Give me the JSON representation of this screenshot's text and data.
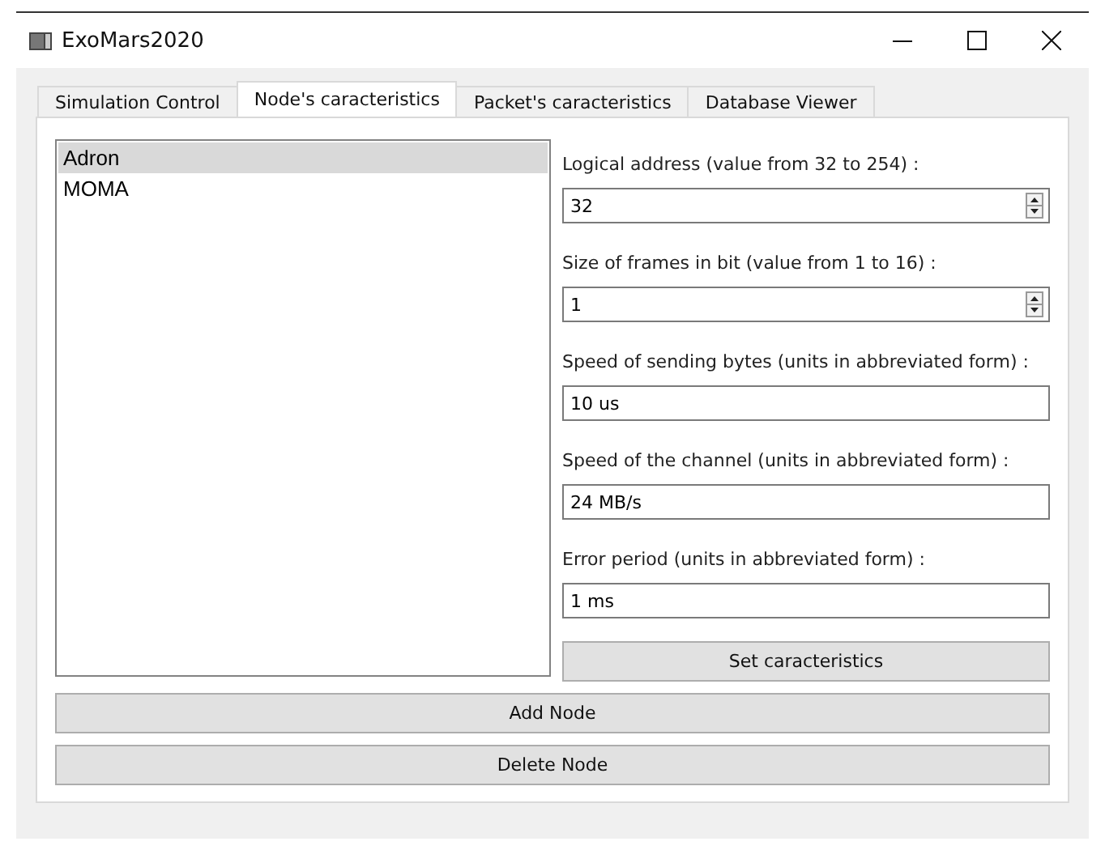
{
  "window": {
    "title": "ExoMars2020"
  },
  "tabs": [
    {
      "label": "Simulation Control",
      "selected": false
    },
    {
      "label": "Node's caracteristics",
      "selected": true
    },
    {
      "label": "Packet's caracteristics",
      "selected": false
    },
    {
      "label": "Database Viewer",
      "selected": false
    }
  ],
  "nodes": [
    {
      "label": "Adron",
      "selected": true
    },
    {
      "label": "MOMA",
      "selected": false
    }
  ],
  "fields": [
    {
      "kind": "spin",
      "label": "Logical address (value from 32 to 254) :",
      "value": "32"
    },
    {
      "kind": "spin",
      "label": "Size of frames in bit (value from 1 to 16) :",
      "value": "1"
    },
    {
      "kind": "text",
      "label": "Speed of sending bytes (units in abbreviated form) :",
      "value": "10 us"
    },
    {
      "kind": "text",
      "label": "Speed of the channel (units in abbreviated form) :",
      "value": "24 MB/s"
    },
    {
      "kind": "text",
      "label": "Error period (units in abbreviated form) :",
      "value": "1 ms"
    }
  ],
  "set_button": "Set caracteristics",
  "buttons": [
    "Add Node",
    "Delete Node"
  ]
}
